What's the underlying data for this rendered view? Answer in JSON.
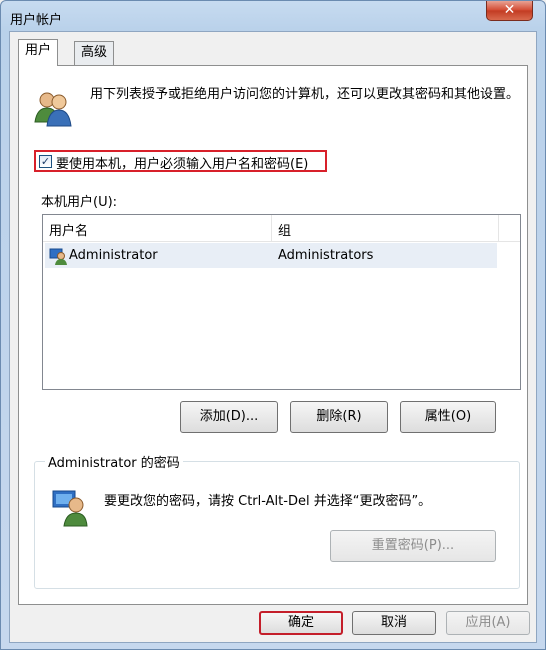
{
  "window": {
    "title": "用户帐户",
    "close_label": "✕"
  },
  "tabs": [
    {
      "label": "用户",
      "active": true
    },
    {
      "label": "高级",
      "active": false
    }
  ],
  "intro_text": "用下列表授予或拒绝用户访问您的计算机，还可以更改其密码和其他设置。",
  "require_login_checkbox": {
    "label": "要使用本机，用户必须输入用户名和密码(E)",
    "checked": true
  },
  "local_users_label": "本机用户(U):",
  "user_list": {
    "columns": [
      "用户名",
      "组"
    ],
    "rows": [
      {
        "name": "Administrator",
        "group": "Administrators"
      }
    ]
  },
  "list_buttons": {
    "add": "添加(D)...",
    "remove": "删除(R)",
    "properties": "属性(O)"
  },
  "password_group": {
    "title": "Administrator 的密码",
    "text": "要更改您的密码，请按 Ctrl-Alt-Del 并选择“更改密码”。",
    "reset_button": "重置密码(P)..."
  },
  "dialog_buttons": {
    "ok": "确定",
    "cancel": "取消",
    "apply": "应用(A)"
  }
}
